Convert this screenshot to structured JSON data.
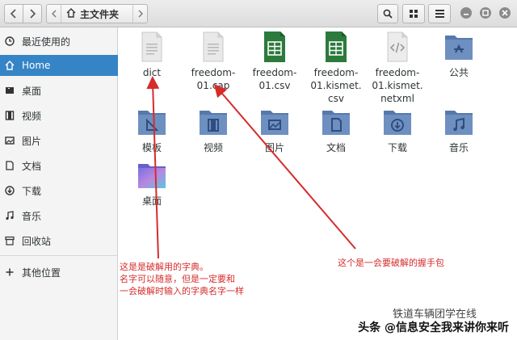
{
  "header": {
    "path_label": "主文件夹",
    "icons": [
      "chevron-left-icon",
      "chevron-right-icon",
      "home-icon",
      "search-icon",
      "grid-view-icon",
      "menu-icon",
      "minimize-icon",
      "maximize-icon",
      "close-icon"
    ]
  },
  "sidebar": {
    "items": [
      {
        "label": "最近使用的",
        "icon": "clock-icon"
      },
      {
        "label": "Home",
        "icon": "home-icon"
      },
      {
        "label": "桌面",
        "icon": "desktop-icon"
      },
      {
        "label": "视频",
        "icon": "video-icon"
      },
      {
        "label": "图片",
        "icon": "image-icon"
      },
      {
        "label": "文档",
        "icon": "document-icon"
      },
      {
        "label": "下载",
        "icon": "download-icon"
      },
      {
        "label": "音乐",
        "icon": "music-icon"
      },
      {
        "label": "回收站",
        "icon": "trash-icon"
      },
      {
        "label": "其他位置",
        "icon": "plus-icon"
      }
    ],
    "active_index": 1
  },
  "files": [
    {
      "label": "dict",
      "type": "text"
    },
    {
      "label": "freedom-\n01.cap",
      "type": "text"
    },
    {
      "label": "freedom-\n01.csv",
      "type": "spreadsheet"
    },
    {
      "label": "freedom-\n01.kismet.\ncsv",
      "type": "spreadsheet"
    },
    {
      "label": "freedom-\n01.kismet.\nnetxml",
      "type": "code"
    },
    {
      "label": "公共",
      "type": "folder-share"
    },
    {
      "label": "模板",
      "type": "folder-template"
    },
    {
      "label": "视频",
      "type": "folder-video"
    },
    {
      "label": "图片",
      "type": "folder-image"
    },
    {
      "label": "文档",
      "type": "folder-document"
    },
    {
      "label": "下载",
      "type": "folder-download"
    },
    {
      "label": "音乐",
      "type": "folder-music"
    },
    {
      "label": "桌面",
      "type": "folder-desktop"
    }
  ],
  "annotations": {
    "left": "这是是破解用的字典。\n名字可以随意，但是一定要和\n一会破解时输入的字典名字一样",
    "right": "这个是一会要破解的握手包"
  },
  "watermark": {
    "text": "头条 @信息安全我来讲你来听",
    "overlay": "铁道车辆团学在线"
  },
  "colors": {
    "accent": "#3584c6",
    "folder": "#6e90c0",
    "spreadsheet": "#2c7a3c",
    "annotation": "#d62c2c"
  }
}
